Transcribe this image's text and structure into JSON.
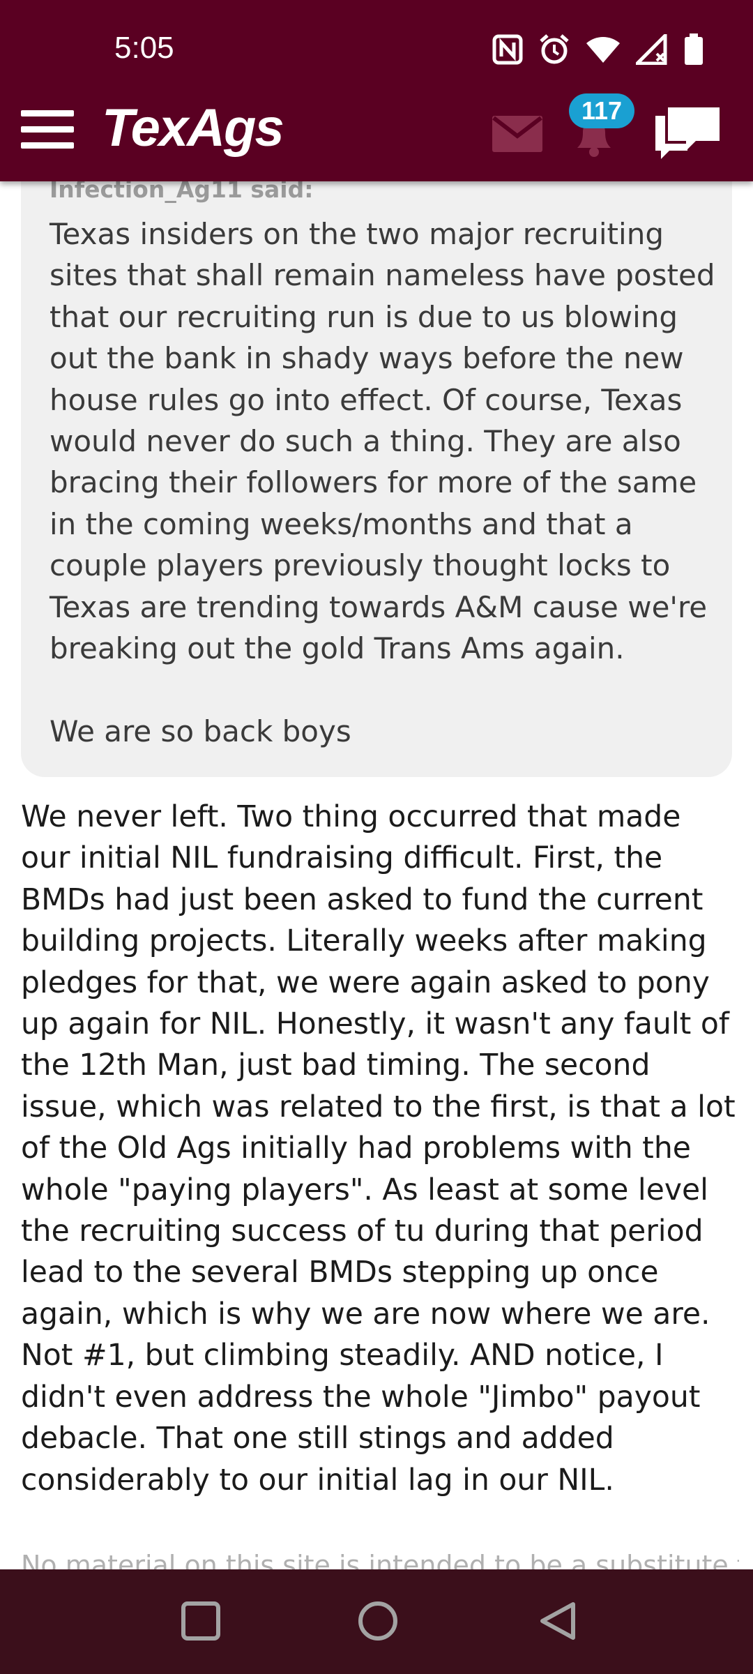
{
  "status_bar": {
    "time": "5:05",
    "icons": [
      "nfc-icon",
      "alarm-icon",
      "wifi-icon",
      "signal-icon",
      "battery-icon"
    ]
  },
  "header": {
    "logo": "TexAgs",
    "notification_count": "117",
    "icons": [
      "menu-icon",
      "mail-icon",
      "bell-icon",
      "chat-icon"
    ]
  },
  "quote": {
    "author": "Infection_Ag11 said:",
    "text": "Texas insiders on the two major recruiting sites that shall remain nameless have posted that our recruiting run is due to us blowing out the bank in shady ways before the new house rules go into effect. Of course, Texas would never do such a thing. They are also bracing their followers for more of the same in the coming weeks/months and that a couple players previously thought locks to Texas are trending towards A&M cause we're breaking out the gold Trans Ams again.\n\nWe are so back boys"
  },
  "post": {
    "text": "We never left. Two thing occurred that made our initial NIL fundraising difficult. First, the BMDs had just been asked to fund the current building projects. Literally weeks after making pledges for that, we were again asked to pony up again for NIL. Honestly, it wasn't any fault of the 12th Man, just bad timing. The second issue, which was related to the first, is that a lot of the Old Ags initially had problems with the whole \"paying players\". As least at some level the recruiting success of tu during that period lead to the several BMDs stepping up once again, which is why we are now where we are. Not #1, but climbing steadily. AND notice, I didn't even address the whole \"Jimbo\" payout debacle. That one still stings and added considerably to our initial lag in our NIL."
  },
  "footer": {
    "disclaimer": "No material on this site is intended to be a substitute for"
  },
  "nav_bar": {
    "icons": [
      "recents-icon",
      "home-icon",
      "back-icon"
    ]
  },
  "colors": {
    "header_bg": "#5a0022",
    "badge": "#1aa0d2",
    "nav_bg": "#3b0f1b",
    "quote_bg": "#f0f0f0"
  }
}
